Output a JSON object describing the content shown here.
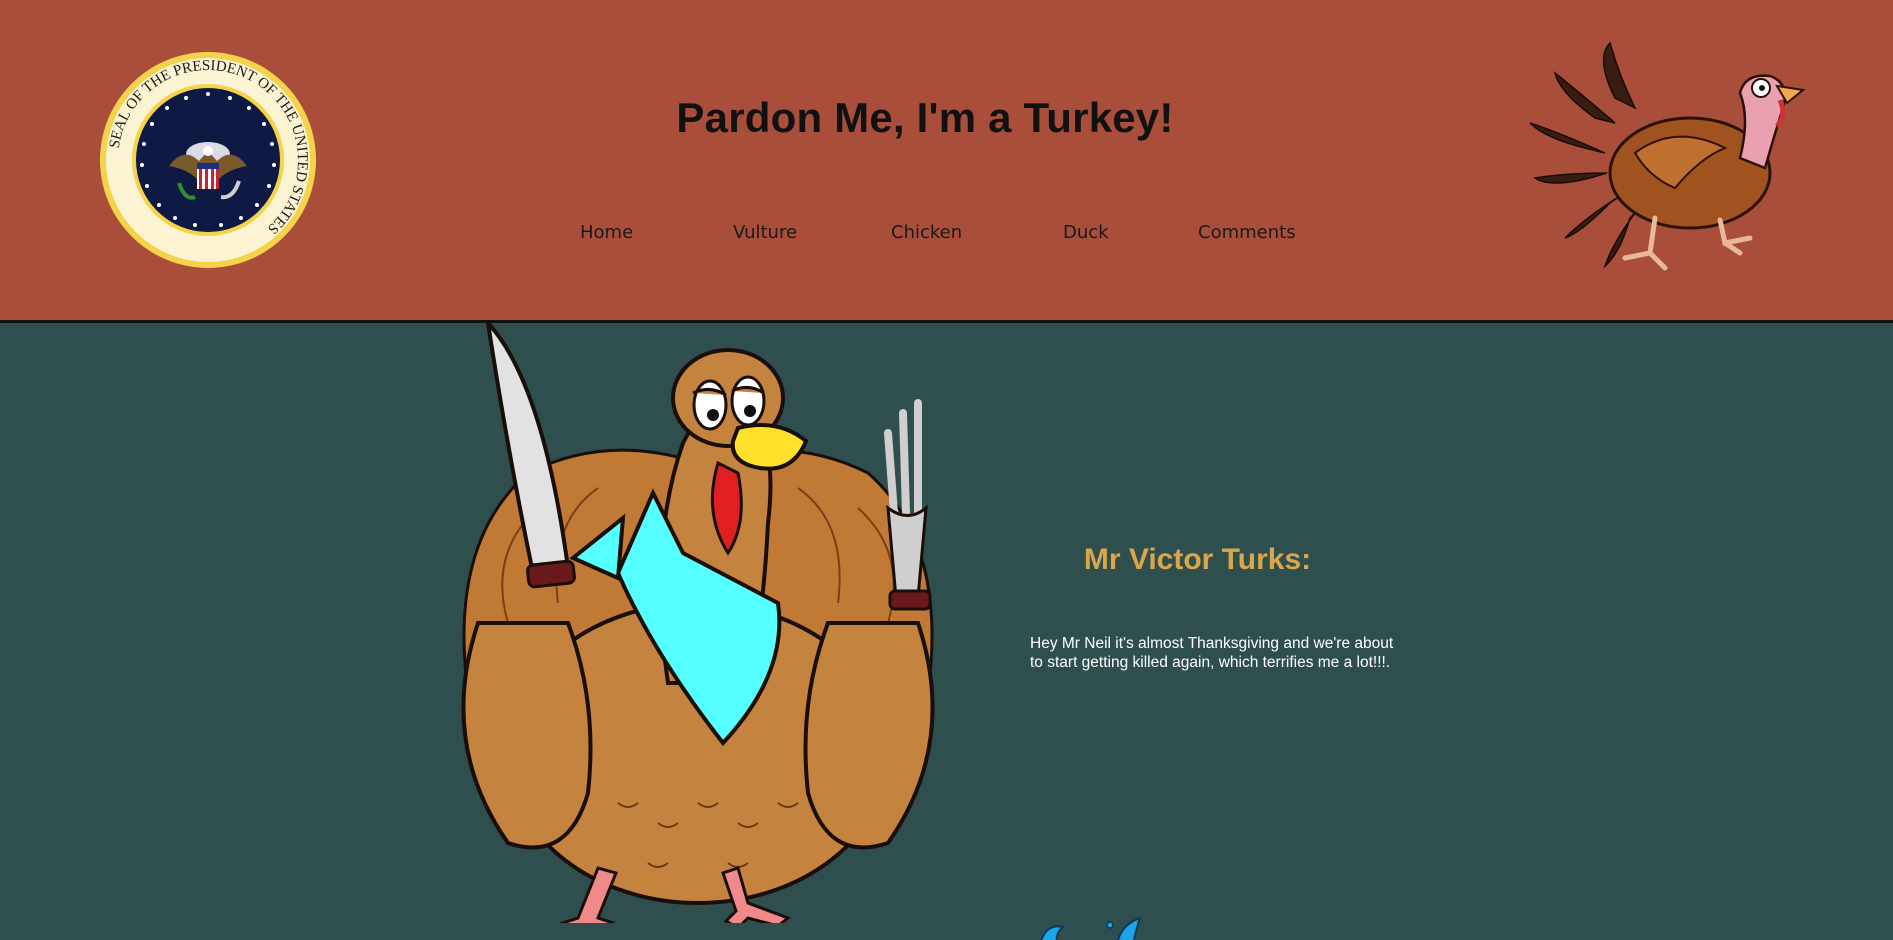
{
  "header": {
    "title": "Pardon Me, I'm a Turkey!",
    "seal_text": "SEAL OF THE PRESIDENT OF THE UNITED STATES"
  },
  "nav": {
    "items": [
      {
        "label": "Home"
      },
      {
        "label": "Vulture"
      },
      {
        "label": "Chicken"
      },
      {
        "label": "Duck"
      },
      {
        "label": "Comments"
      }
    ]
  },
  "main": {
    "quote_author": "Mr Victor Turks:",
    "quote_text": "Hey Mr Neil it's almost Thanksgiving and we're about to start getting killed again, which terrifies me a lot!!!."
  },
  "colors": {
    "header_bg": "#a84e3a",
    "main_bg": "#2f4f4f",
    "accent_gold": "#d9a74a"
  },
  "icons": {
    "seal": "presidential-seal-icon",
    "header_turkey": "running-turkey-icon",
    "main_turkey": "turkey-with-knife-and-fork-icon",
    "splash": "water-splash-icon"
  }
}
